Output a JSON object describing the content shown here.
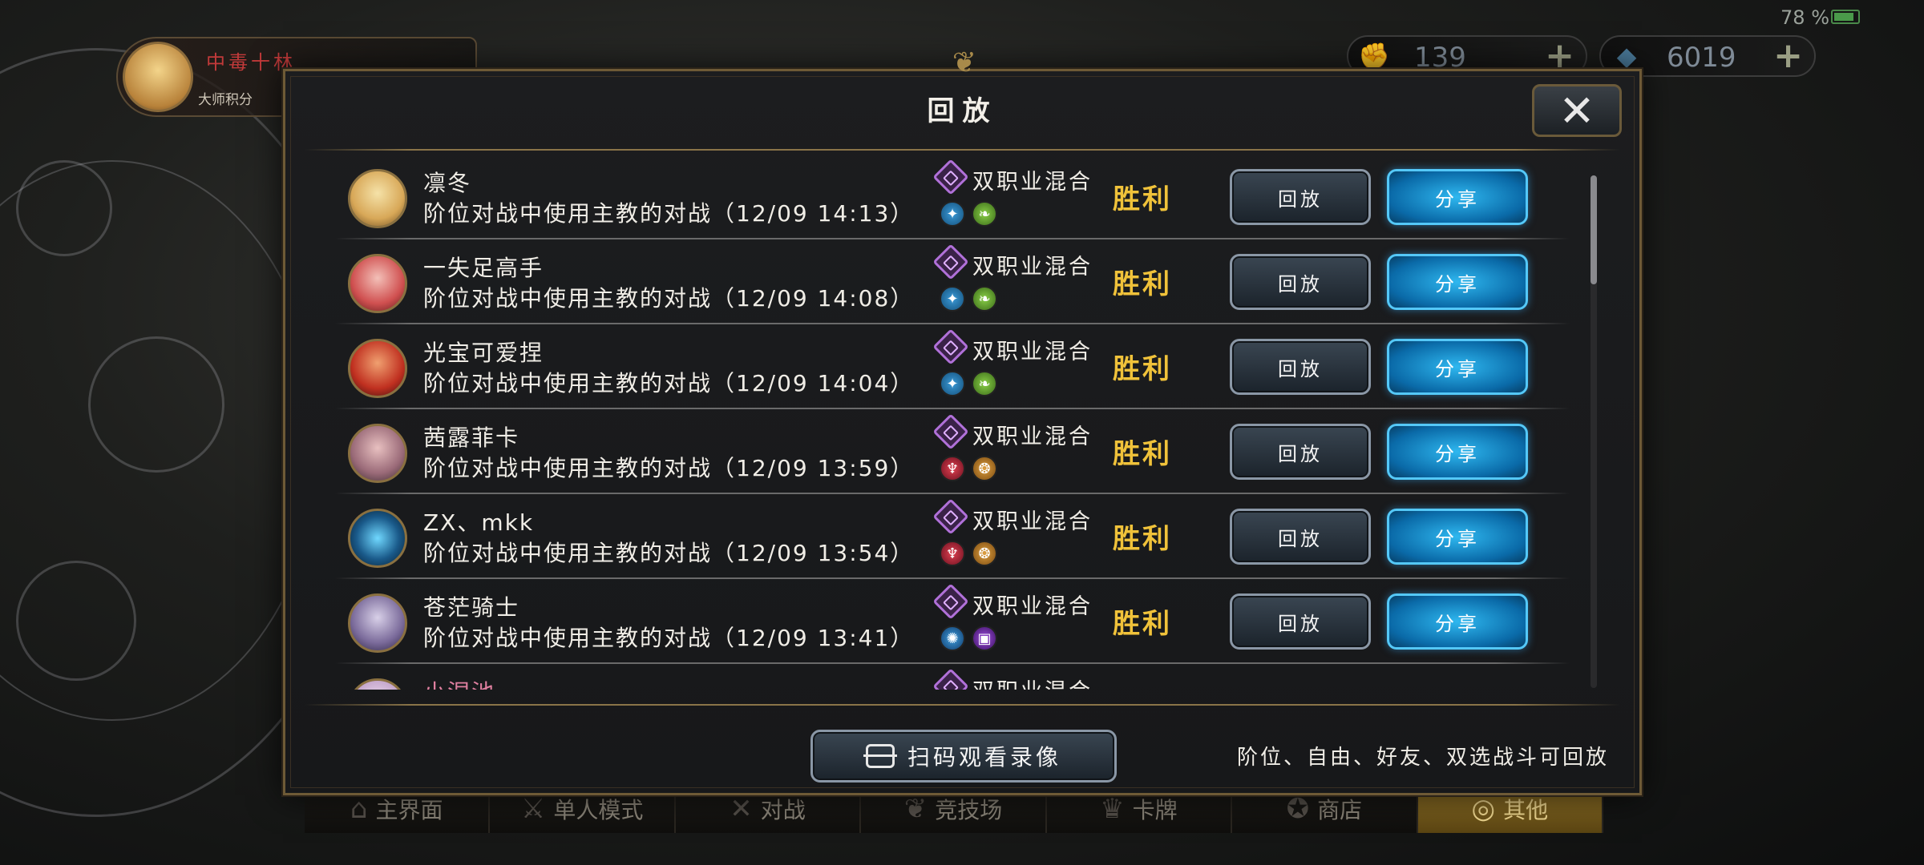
{
  "status": {
    "battery": "78"
  },
  "player": {
    "name": "中毒十林",
    "rank": "大师积分"
  },
  "currency": {
    "gold": {
      "icon": "fist-coin-icon",
      "value": "139"
    },
    "gems": {
      "icon": "crystal-icon",
      "value": "6019"
    }
  },
  "dialog": {
    "title": "回放",
    "close_label": "✕",
    "scan_button": "扫码观看录像",
    "hint": "阶位、自由、好友、双选战斗可回放"
  },
  "replay_label": "回放",
  "share_label": "分享",
  "entries": [
    {
      "name": "凛冬",
      "desc": "阶位对战中使用主教的对战（12/09 14:13）",
      "mode": "双职业混合",
      "result": "胜利",
      "class_icons": [
        "bishop-icon",
        "forest-icon"
      ]
    },
    {
      "name": "一失足高手",
      "desc": "阶位对战中使用主教的对战（12/09 14:08）",
      "mode": "双职业混合",
      "result": "胜利",
      "class_icons": [
        "bishop-icon",
        "forest-icon"
      ]
    },
    {
      "name": "光宝可爱捏",
      "desc": "阶位对战中使用主教的对战（12/09 14:04）",
      "mode": "双职业混合",
      "result": "胜利",
      "class_icons": [
        "bishop-icon",
        "forest-icon"
      ]
    },
    {
      "name": "茜露菲卡",
      "desc": "阶位对战中使用主教的对战（12/09 13:59）",
      "mode": "双职业混合",
      "result": "胜利",
      "class_icons": [
        "blood-icon",
        "dragon-icon"
      ]
    },
    {
      "name": "ZX、mkk",
      "desc": "阶位对战中使用主教的对战（12/09 13:54）",
      "mode": "双职业混合",
      "result": "胜利",
      "class_icons": [
        "blood-icon",
        "dragon-icon"
      ]
    },
    {
      "name": "苍茫骑士",
      "desc": "阶位对战中使用主教的对战（12/09 13:41）",
      "mode": "双职业混合",
      "result": "胜利",
      "class_icons": [
        "portal-icon",
        "rune-icon"
      ]
    },
    {
      "name": "小涅池",
      "desc": "",
      "mode": "双职业混合",
      "result": "",
      "class_icons": []
    }
  ],
  "nav": [
    "主界面",
    "单人模式",
    "对战",
    "竞技场",
    "卡牌",
    "商店",
    "其他"
  ],
  "colors": {
    "win": "#f0c23a",
    "share_button": "#1a90d0",
    "mode_icon": "#b070d8"
  }
}
